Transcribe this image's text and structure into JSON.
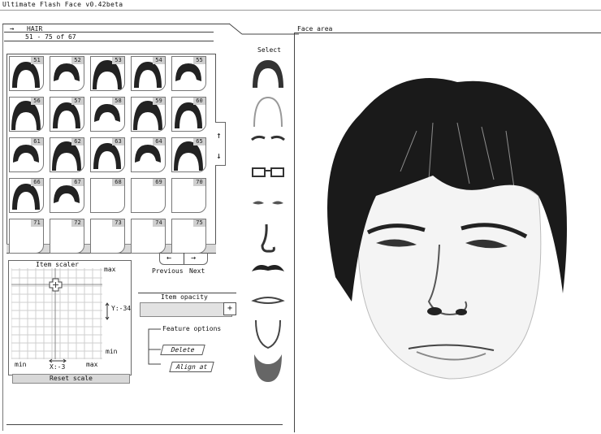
{
  "app": {
    "title": "Ultimate Flash Face v0.42beta"
  },
  "category": {
    "arrow": "→",
    "name": "HAIR",
    "range": "51 - 75 of 67"
  },
  "grid": {
    "items": [
      {
        "num": "51",
        "filled": true
      },
      {
        "num": "52",
        "filled": true
      },
      {
        "num": "53",
        "filled": true
      },
      {
        "num": "54",
        "filled": true
      },
      {
        "num": "55",
        "filled": true
      },
      {
        "num": "56",
        "filled": true
      },
      {
        "num": "57",
        "filled": true
      },
      {
        "num": "58",
        "filled": true
      },
      {
        "num": "59",
        "filled": true
      },
      {
        "num": "60",
        "filled": true
      },
      {
        "num": "61",
        "filled": true
      },
      {
        "num": "62",
        "filled": true
      },
      {
        "num": "63",
        "filled": true
      },
      {
        "num": "64",
        "filled": true
      },
      {
        "num": "65",
        "filled": true
      },
      {
        "num": "66",
        "filled": true
      },
      {
        "num": "67",
        "filled": true
      },
      {
        "num": "68",
        "filled": false
      },
      {
        "num": "69",
        "filled": false
      },
      {
        "num": "70",
        "filled": false
      },
      {
        "num": "71",
        "filled": false
      },
      {
        "num": "72",
        "filled": false
      },
      {
        "num": "73",
        "filled": false
      },
      {
        "num": "74",
        "filled": false
      },
      {
        "num": "75",
        "filled": false
      }
    ]
  },
  "scroll": {
    "up": "↑",
    "down": "↓"
  },
  "pager": {
    "prev_arrow": "←",
    "next_arrow": "→",
    "prev_label": "Previous",
    "next_label": "Next"
  },
  "scaler": {
    "title": "Item scaler",
    "max_top": "max",
    "min_right": "min",
    "min_bottom": "min",
    "max_bottom": "max",
    "y_readout": "Y:-34",
    "x_readout": "X:-3",
    "reset": "Reset scale"
  },
  "opacity": {
    "label": "Item opacity",
    "value": 1.0
  },
  "feature_options": {
    "label": "Feature options",
    "delete": "Delete",
    "align": "Align at"
  },
  "select": {
    "label": "Select",
    "features": [
      "hair-icon",
      "head-shape-icon",
      "eyebrows-icon",
      "glasses-icon",
      "eyes-icon",
      "nose-icon",
      "mustache-icon",
      "lips-icon",
      "jaw-icon",
      "beard-icon"
    ]
  },
  "face_area": {
    "label": "Face area"
  }
}
